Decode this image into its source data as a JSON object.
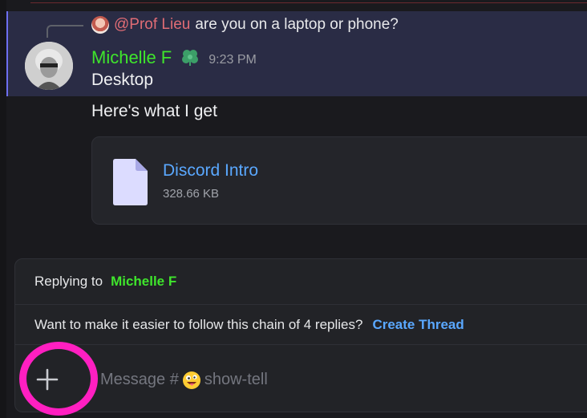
{
  "reply_reference": {
    "mention": "@Prof Lieu",
    "text": "are you on a laptop or phone?"
  },
  "message": {
    "author": "Michelle F",
    "timestamp": "9:23 PM",
    "lines": [
      "Desktop",
      "Here's what I get"
    ],
    "author_color": "#3fe52c",
    "badge_icon": "clover-icon"
  },
  "attachment": {
    "name": "Discord Intro",
    "size": "328.66 KB",
    "icon": "file-icon"
  },
  "composer": {
    "replying_label": "Replying to",
    "replying_to": "Michelle F",
    "thread_prompt": "Want to make it easier to follow this chain of 4 replies?",
    "thread_action": "Create Thread",
    "placeholder_prefix": "Message #",
    "channel": "show-tell",
    "channel_emoji": "goofy-face-emoji",
    "add_button_icon": "plus-icon"
  },
  "colors": {
    "accent_link": "#5aa8ff",
    "mention": "#e06c75",
    "highlight_bg": "#2a2c45",
    "annotation_ring": "#ff1fc1"
  }
}
